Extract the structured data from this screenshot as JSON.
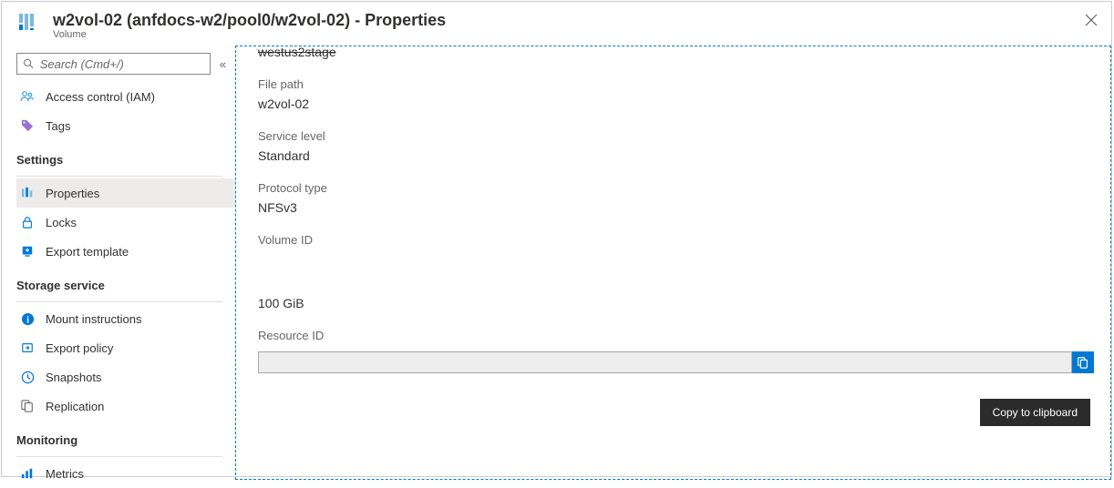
{
  "header": {
    "title": "w2vol-02 (anfdocs-w2/pool0/w2vol-02) - Properties",
    "subtitle": "Volume"
  },
  "search": {
    "placeholder": "Search (Cmd+/)"
  },
  "nav": {
    "access_control": "Access control (IAM)",
    "tags": "Tags",
    "section_settings": "Settings",
    "properties": "Properties",
    "locks": "Locks",
    "export_template": "Export template",
    "section_storage": "Storage service",
    "mount_instructions": "Mount instructions",
    "export_policy": "Export policy",
    "snapshots": "Snapshots",
    "replication": "Replication",
    "section_monitoring": "Monitoring",
    "metrics": "Metrics"
  },
  "content": {
    "truncated_top": "westus2stage",
    "file_path_label": "File path",
    "file_path_value": "w2vol-02",
    "service_level_label": "Service level",
    "service_level_value": "Standard",
    "protocol_type_label": "Protocol type",
    "protocol_type_value": "NFSv3",
    "volume_id_label": "Volume ID",
    "size_value": "100 GiB",
    "resource_id_label": "Resource ID"
  },
  "tooltip": {
    "copy": "Copy to clipboard"
  }
}
